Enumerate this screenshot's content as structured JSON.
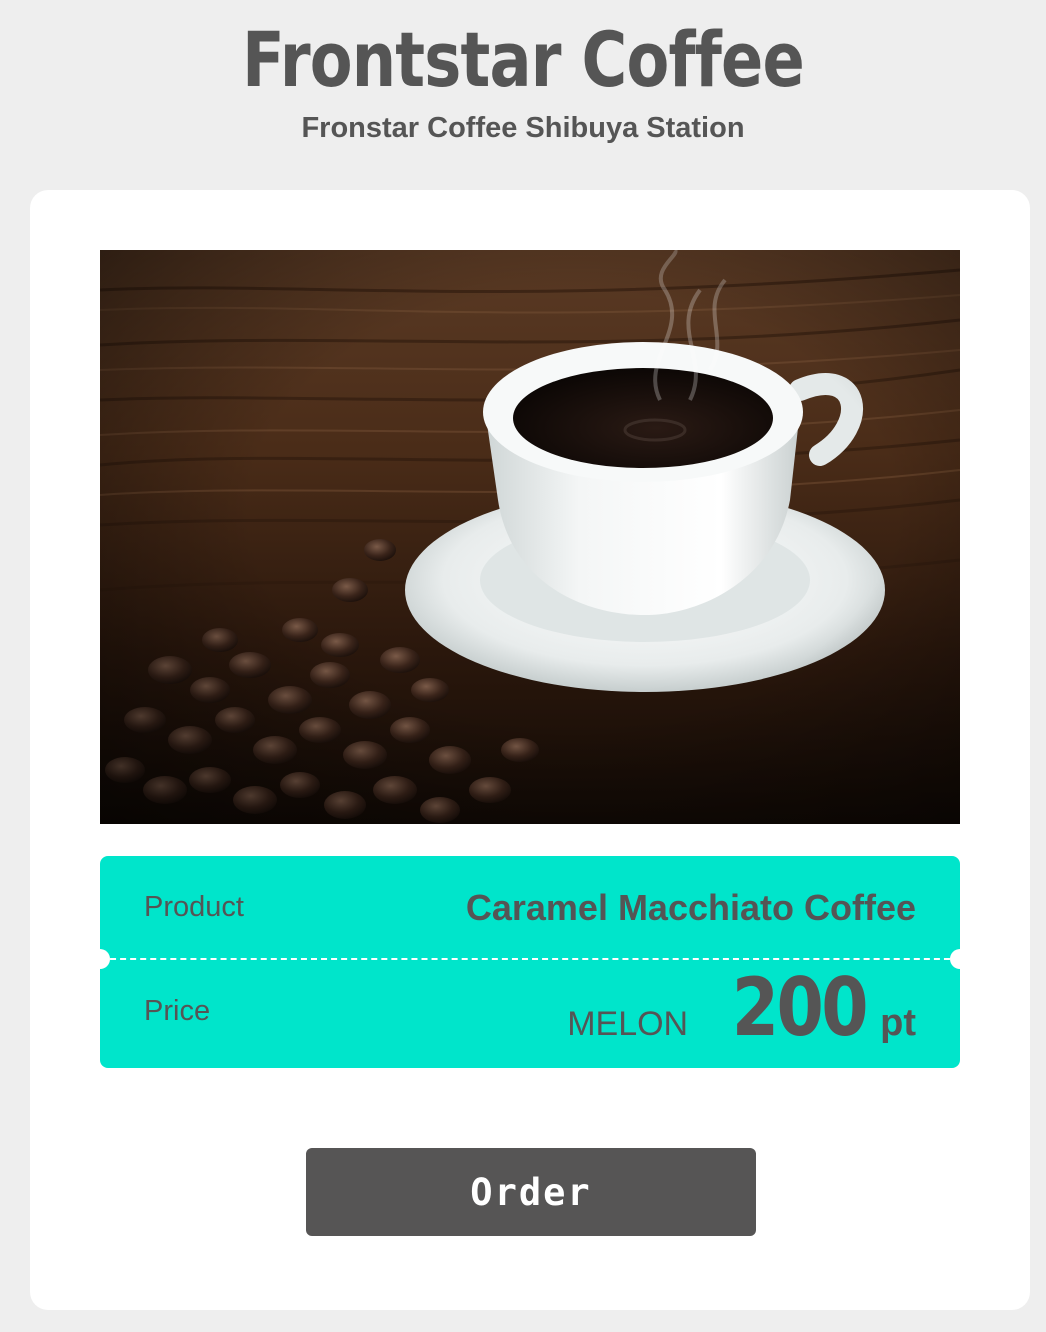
{
  "header": {
    "brand": "Frontstar Coffee",
    "store": "Fronstar Coffee Shibuya Station"
  },
  "product_photo": {
    "icon": "coffee-cup-photo"
  },
  "ticket": {
    "product_label": "Product",
    "product_value": "Caramel Macchiato Coffee",
    "price_label": "Price",
    "currency": "MELON",
    "amount": "200",
    "unit": "pt"
  },
  "actions": {
    "order_label": "Order"
  },
  "colors": {
    "background": "#eeeeee",
    "card": "#ffffff",
    "ticket": "#00e5cb",
    "text": "#555555",
    "button": "#565555",
    "button_text": "#ffffff"
  }
}
